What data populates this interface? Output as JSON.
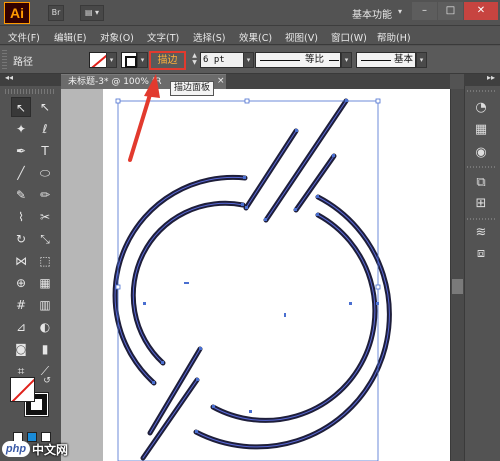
{
  "app": {
    "logo_text": "Ai",
    "workspace": "基本功能",
    "win_minimize": "–",
    "win_maximize": "□",
    "win_close": "✕"
  },
  "titlebar": {
    "btn_bridge": "Br",
    "btn_arrange": "▤ ▾"
  },
  "menu": [
    "文件(F)",
    "编辑(E)",
    "对象(O)",
    "文字(T)",
    "选择(S)",
    "效果(C)",
    "视图(V)",
    "窗口(W)",
    "帮助(H)"
  ],
  "control": {
    "selection_label": "路径",
    "stroke_label": "描边",
    "stroke_weight": "6 pt",
    "profile_label": "等比",
    "brush_label": "基本"
  },
  "tooltip": "描边面板",
  "document": {
    "tab_title": "未标题-3* @ 100% (R",
    "tab_close": "×"
  },
  "left_panel": {
    "collapse": "◂◂"
  },
  "right_panel": {
    "collapse": "▸▸"
  },
  "colors": {
    "accent_orange": "#ffb13b",
    "highlight_red": "#e23a2e",
    "stroke_dark": "#1e1e3a",
    "anchor_blue": "#4a6fd0"
  },
  "watermark": {
    "logo": "php",
    "text": "中文网"
  }
}
